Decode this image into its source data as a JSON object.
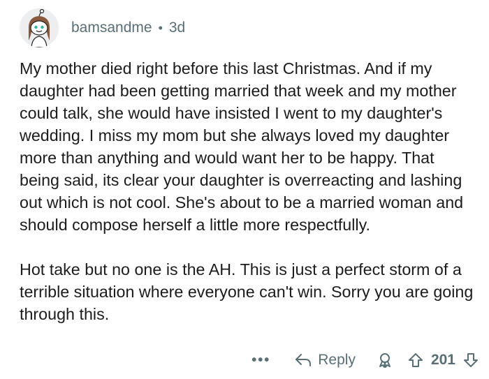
{
  "comment": {
    "author": "bamsandme",
    "separator": "•",
    "age": "3d",
    "paragraphs": [
      "My mother died right before this last Christmas. And if my daughter had been getting married that week and my mother could talk, she would have insisted I went to my daughter's wedding. I miss my mom but she always loved my daughter more than anything and would want her to be happy. That being said, its clear your daughter is overreacting and lashing out which is not cool. She's about to be a married woman and should compose herself a little more respectfully.",
      "Hot take but no one is the AH. This is just a perfect storm of a terrible situation where everyone can't win. Sorry you are going through this."
    ]
  },
  "actions": {
    "more": "•••",
    "reply_label": "Reply",
    "vote_count": "201"
  },
  "icons": {
    "avatar": "snoo-avatar",
    "reply": "reply-arrow-icon",
    "award": "award-icon",
    "upvote": "upvote-arrow-icon",
    "downvote": "downvote-arrow-icon"
  },
  "colors": {
    "meta_text": "#576f76",
    "body_text": "#1c1c1c"
  }
}
